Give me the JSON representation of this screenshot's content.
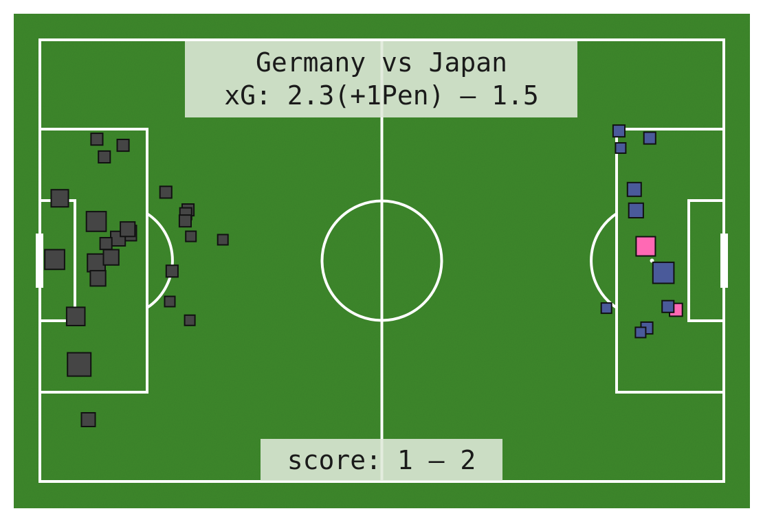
{
  "colors": {
    "pitch": "#3f8a2f",
    "lines": "#ffffff",
    "home_shot": "#454545",
    "away_shot": "#4a5a9a",
    "away_goal": "#ff69b4",
    "label_box": "#dfe9d9"
  },
  "header": {
    "title": "Germany vs Japan",
    "xg_line": "xG: 2.3(+1Pen) – 1.5"
  },
  "footer": {
    "score_line": "score: 1 – 2"
  },
  "chart_data": {
    "type": "scatter",
    "title": "Germany vs Japan",
    "subtitle": "xG: 2.3(+1Pen) – 1.5",
    "annotation": "score: 1 – 2",
    "xlim": [
      0,
      120
    ],
    "ylim": [
      0,
      80
    ],
    "grid": false,
    "series": [
      {
        "name": "Germany",
        "color": "#454545",
        "attacks": "left goal",
        "shots": [
          {
            "x": 2.6,
            "y": 39.8,
            "xg": 0.14,
            "goal": false
          },
          {
            "x": 3.5,
            "y": 28.7,
            "xg": 0.09,
            "goal": false
          },
          {
            "x": 6.3,
            "y": 50.1,
            "xg": 0.11,
            "goal": false
          },
          {
            "x": 6.9,
            "y": 58.8,
            "xg": 0.23,
            "goal": false
          },
          {
            "x": 8.5,
            "y": 68.8,
            "xg": 0.04,
            "goal": false
          },
          {
            "x": 9.9,
            "y": 32.9,
            "xg": 0.14,
            "goal": false
          },
          {
            "x": 9.9,
            "y": 40.4,
            "xg": 0.1,
            "goal": false
          },
          {
            "x": 10.2,
            "y": 43.2,
            "xg": 0.06,
            "goal": false
          },
          {
            "x": 11.3,
            "y": 21.2,
            "xg": 0.02,
            "goal": false
          },
          {
            "x": 11.6,
            "y": 36.9,
            "xg": 0.02,
            "goal": false
          },
          {
            "x": 12.5,
            "y": 39.4,
            "xg": 0.06,
            "goal": false
          },
          {
            "x": 13.7,
            "y": 36.0,
            "xg": 0.05,
            "goal": false
          },
          {
            "x": 15.4,
            "y": 34.3,
            "xg": 0.05,
            "goal": false
          },
          {
            "x": 15.6,
            "y": 35.0,
            "xg": 0.06,
            "goal": false
          },
          {
            "x": 10.0,
            "y": 18.0,
            "xg": 0.02,
            "goal": false
          },
          {
            "x": 14.6,
            "y": 19.1,
            "xg": 0.02,
            "goal": false
          },
          {
            "x": 23.2,
            "y": 41.9,
            "xg": 0.02,
            "goal": false
          },
          {
            "x": 22.1,
            "y": 27.6,
            "xg": 0.02,
            "goal": false
          },
          {
            "x": 26.0,
            "y": 30.8,
            "xg": 0.02,
            "goal": false
          },
          {
            "x": 25.6,
            "y": 31.5,
            "xg": 0.02,
            "goal": false
          },
          {
            "x": 25.5,
            "y": 32.8,
            "xg": 0.02,
            "goal": false
          },
          {
            "x": 26.5,
            "y": 35.6,
            "xg": 0.01,
            "goal": false
          },
          {
            "x": 32.1,
            "y": 36.2,
            "xg": 0.01,
            "goal": false
          },
          {
            "x": 22.8,
            "y": 47.4,
            "xg": 0.01,
            "goal": false
          },
          {
            "x": 26.3,
            "y": 50.8,
            "xg": 0.01,
            "goal": false
          }
        ]
      },
      {
        "name": "Japan",
        "color": "#4a5a9a",
        "attacks": "right goal",
        "shots": [
          {
            "x": 101.6,
            "y": 16.5,
            "xg": 0.02,
            "goal": false
          },
          {
            "x": 107.0,
            "y": 17.8,
            "xg": 0.02,
            "goal": false
          },
          {
            "x": 101.9,
            "y": 19.6,
            "xg": 0.01,
            "goal": false
          },
          {
            "x": 104.6,
            "y": 30.9,
            "xg": 0.05,
            "goal": false
          },
          {
            "x": 104.3,
            "y": 27.1,
            "xg": 0.04,
            "goal": false
          },
          {
            "x": 106.3,
            "y": 37.4,
            "xg": 0.13,
            "goal": true
          },
          {
            "x": 109.4,
            "y": 42.2,
            "xg": 0.17,
            "goal": false
          },
          {
            "x": 110.2,
            "y": 48.3,
            "xg": 0.02,
            "goal": false
          },
          {
            "x": 111.6,
            "y": 48.9,
            "xg": 0.03,
            "goal": true
          },
          {
            "x": 106.5,
            "y": 52.2,
            "xg": 0.02,
            "goal": false
          },
          {
            "x": 105.4,
            "y": 53.0,
            "xg": 0.01,
            "goal": false
          },
          {
            "x": 99.4,
            "y": 48.6,
            "xg": 0.01,
            "goal": false
          }
        ]
      }
    ],
    "legend": "none"
  }
}
